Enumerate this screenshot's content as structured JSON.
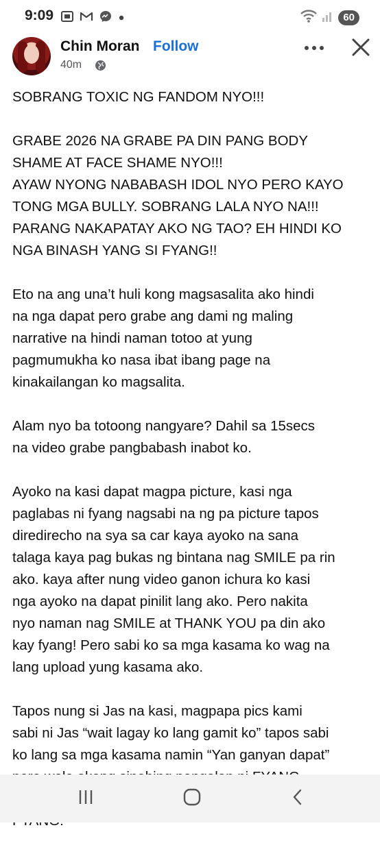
{
  "status_bar": {
    "time": "9:09",
    "left_icons": [
      "screenshot-icon",
      "gmail-icon",
      "messenger-icon",
      "dot-icon"
    ],
    "right_icons": [
      "wifi-icon",
      "signal-icon"
    ],
    "battery": "60"
  },
  "post": {
    "author": "Chin Moran",
    "separator": "·",
    "follow_label": "Follow",
    "time": "40m",
    "audience_icon": "globe-icon",
    "paragraphs": [
      "SOBRANG TOXIC NG FANDOM NYO!!!",
      "GRABE 2026 NA GRABE PA DIN PANG BODY\nSHAME AT FACE SHAME NYO!!!\nAYAW NYONG NABABASH IDOL NYO PERO KAYO\nTONG MGA BULLY. SOBRANG LALA NYO NA!!!\nPARANG NAKAPATAY AKO NG TAO? EH HINDI KO\nNGA BINASH YANG SI FYANG!!",
      "Eto na ang una’t huli kong magsasalita ako hindi\nna nga dapat pero grabe ang dami ng maling\nnarrative na hindi naman totoo at yung\npagmumukha ko nasa ibat ibang page na\nkinakailangan ko magsalita.",
      "Alam nyo ba totoong nangyare? Dahil sa 15secs\nna video grabe pangbabash inabot ko.",
      "Ayoko na kasi dapat magpa picture, kasi nga\npaglabas ni fyang nagsabi na ng pa picture tapos\ndiredirecho na sya sa car kaya ayoko na sana\ntalaga kaya pag bukas ng bintana nag SMILE pa rin\nako. kaya after nung video ganon ichura ko kasi\nnga ayoko na dapat pinilit lang ako. Pero nakita\nnyo naman nag SMILE at THANK YOU pa din ako\nkay fyang! Pero sabi ko sa mga kasama ko wag na\nlang upload yung kasama ako.",
      "Tapos nung si Jas na kasi, magpapa pics kami\nsabi ni Jas “wait lagay ko lang gamit ko” tapos sabi\nko lang sa mga kasama namin “Yan ganyan dapat”\npero wala akong sinabing pangalan ni FYANG\nDYAN, kayo lang nag connect nyan lahat kay\nFYANG!"
    ]
  },
  "nav_bar": {
    "icons": [
      "recent-apps-icon",
      "home-icon",
      "back-icon"
    ]
  }
}
